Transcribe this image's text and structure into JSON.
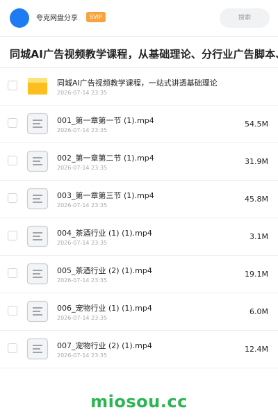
{
  "header": {
    "brand": "夸克网盘分享",
    "badge": "SVIP",
    "search_placeholder": "搜索"
  },
  "page_title": "同城AI广告视频教学课程，从基础理论、分行业广告脚本、",
  "folder": {
    "name": "同城AI广告视频教学课程，一站式讲透基础理论",
    "date": "2026-07-14 23:35",
    "icon": "folder-icon",
    "color": "#fdbf1d"
  },
  "files": [
    {
      "name": "001_第一章第一节 (1).mp4",
      "date": "2026-07-14 23:35",
      "size": "54.5M",
      "icon": "file-doc-icon"
    },
    {
      "name": "002_第一章第二节 (1).mp4",
      "date": "2026-07-14 23:35",
      "size": "31.9M",
      "icon": "file-doc-icon"
    },
    {
      "name": "003_第一章第三节 (1).mp4",
      "date": "2026-07-14 23:35",
      "size": "45.8M",
      "icon": "file-doc-icon"
    },
    {
      "name": "004_茶酒行业 (1) (1).mp4",
      "date": "2026-07-14 23:35",
      "size": "3.1M",
      "icon": "file-doc-icon"
    },
    {
      "name": "005_茶酒行业 (2) (1).mp4",
      "date": "2026-07-14 23:35",
      "size": "19.1M",
      "icon": "file-doc-icon"
    },
    {
      "name": "006_宠物行业 (1) (1).mp4",
      "date": "2026-07-14 23:35",
      "size": "6.0M",
      "icon": "file-doc-icon"
    },
    {
      "name": "007_宠物行业 (2) (1).mp4",
      "date": "2026-07-14 23:35",
      "size": "12.4M",
      "icon": "file-doc-icon"
    }
  ],
  "watermark": "miosou.cc"
}
